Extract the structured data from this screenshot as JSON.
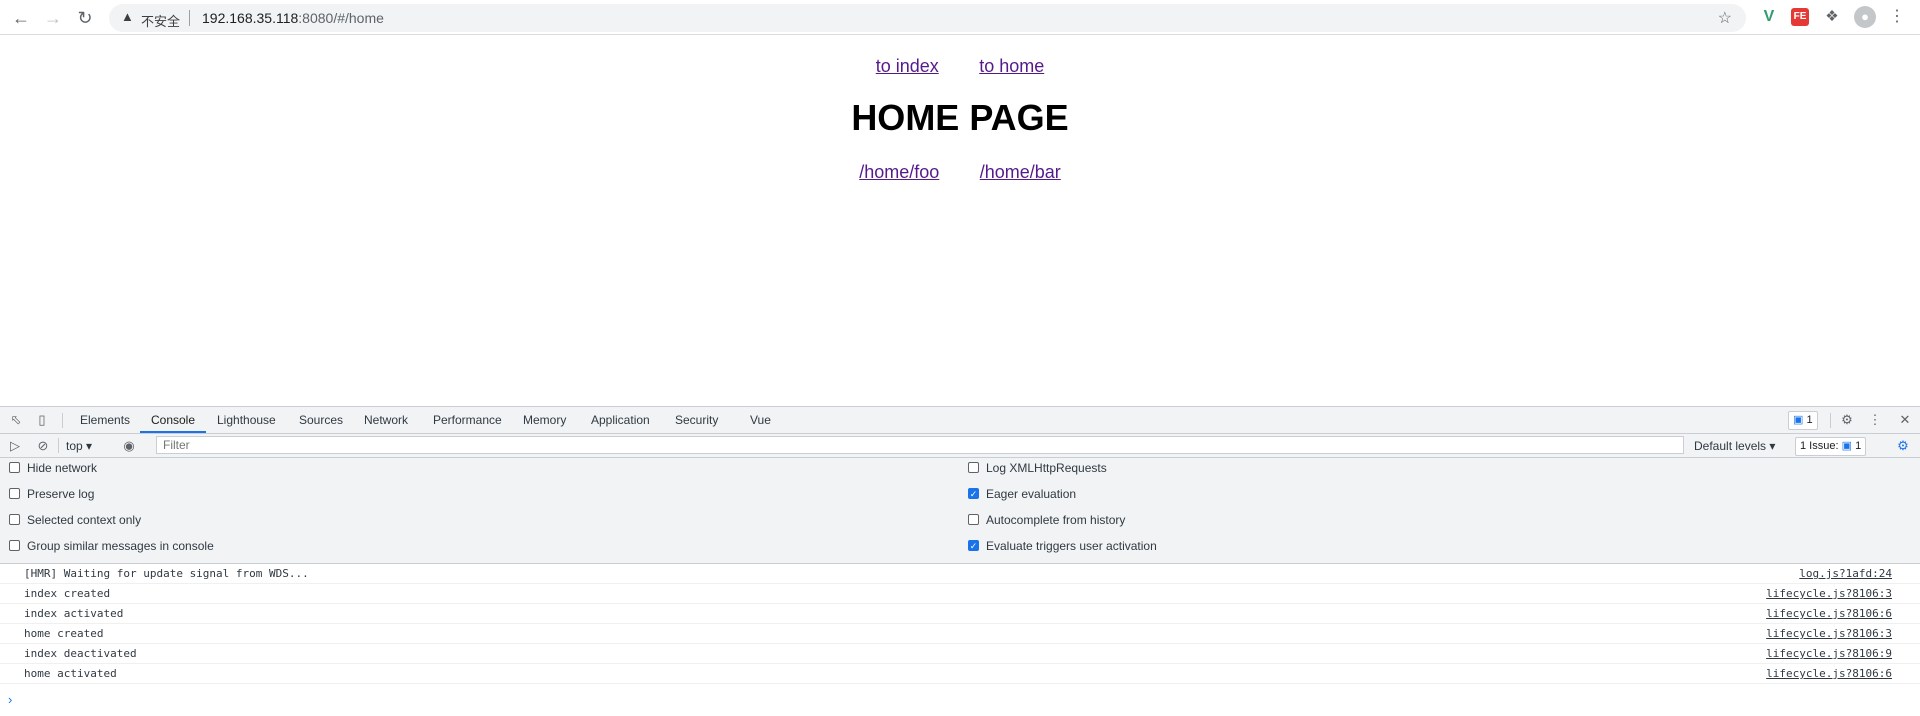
{
  "browser": {
    "security_label": "不安全",
    "url_host": "192.168.35.118",
    "url_rest": ":8080/#/home"
  },
  "page": {
    "nav_links": [
      "to index",
      "to home"
    ],
    "heading": "HOME PAGE",
    "sub_links": [
      "/home/foo",
      "/home/bar"
    ]
  },
  "devtools": {
    "tabs": [
      "Elements",
      "Console",
      "Lighthouse",
      "Sources",
      "Network",
      "Performance",
      "Memory",
      "Application",
      "Security",
      "Vue"
    ],
    "active_tab": "Console",
    "issues_badge_count": "1",
    "context": "top",
    "filter_placeholder": "Filter",
    "levels": "Default levels",
    "issues_label": "1 Issue:",
    "issues_count": "1",
    "settings_left": [
      {
        "label": "Hide network",
        "checked": false
      },
      {
        "label": "Preserve log",
        "checked": false
      },
      {
        "label": "Selected context only",
        "checked": false
      },
      {
        "label": "Group similar messages in console",
        "checked": false
      }
    ],
    "settings_right": [
      {
        "label": "Log XMLHttpRequests",
        "checked": false
      },
      {
        "label": "Eager evaluation",
        "checked": true
      },
      {
        "label": "Autocomplete from history",
        "checked": false
      },
      {
        "label": "Evaluate triggers user activation",
        "checked": true
      }
    ],
    "console_messages": [
      {
        "text": "[HMR] Waiting for update signal from WDS...",
        "source": "log.js?1afd:24"
      },
      {
        "text": "index created",
        "source": "lifecycle.js?8106:3"
      },
      {
        "text": "index activated",
        "source": "lifecycle.js?8106:6"
      },
      {
        "text": "home created",
        "source": "lifecycle.js?8106:3"
      },
      {
        "text": "index deactivated",
        "source": "lifecycle.js?8106:9"
      },
      {
        "text": "home activated",
        "source": "lifecycle.js?8106:6"
      }
    ],
    "colors": {
      "accent": "#1a73e8",
      "link_visited": "#551a8b"
    }
  }
}
